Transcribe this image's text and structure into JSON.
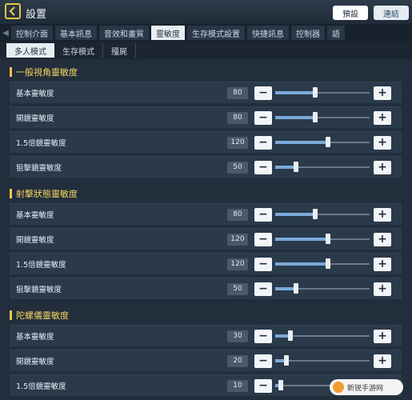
{
  "header": {
    "title": "設置",
    "preset_label": "預設",
    "connect_label": "連結"
  },
  "tabs": [
    {
      "label": "控制介面",
      "active": false
    },
    {
      "label": "基本訊息",
      "active": false
    },
    {
      "label": "音效和畫質",
      "active": false
    },
    {
      "label": "靈敏度",
      "active": true
    },
    {
      "label": "生存模式設置",
      "active": false
    },
    {
      "label": "快捷訊息",
      "active": false
    },
    {
      "label": "控制器",
      "active": false
    },
    {
      "label": "語",
      "active": false
    }
  ],
  "subtabs": [
    {
      "label": "多人模式",
      "active": true
    },
    {
      "label": "生存模式",
      "active": false
    },
    {
      "label": "殭屍",
      "active": false
    }
  ],
  "sections": [
    {
      "title": "一般視角靈敏度",
      "rows": [
        {
          "label": "基本靈敏度",
          "value": "80",
          "level": 0.42
        },
        {
          "label": "開鏡靈敏度",
          "value": "80",
          "level": 0.42
        },
        {
          "label": "1.5倍鏡靈敏度",
          "value": "120",
          "level": 0.56
        },
        {
          "label": "狙擊鏡靈敏度",
          "value": "50",
          "level": 0.22
        }
      ]
    },
    {
      "title": "射擊狀態靈敏度",
      "rows": [
        {
          "label": "基本靈敏度",
          "value": "80",
          "level": 0.42
        },
        {
          "label": "開鏡靈敏度",
          "value": "120",
          "level": 0.56
        },
        {
          "label": "1.5倍鏡靈敏度",
          "value": "120",
          "level": 0.56
        },
        {
          "label": "狙擊鏡靈敏度",
          "value": "50",
          "level": 0.22
        }
      ]
    },
    {
      "title": "陀螺儀靈敏度",
      "rows": [
        {
          "label": "基本靈敏度",
          "value": "30",
          "level": 0.16
        },
        {
          "label": "開鏡靈敏度",
          "value": "20",
          "level": 0.12
        },
        {
          "label": "1.5倍鏡靈敏度",
          "value": "10",
          "level": 0.06
        }
      ]
    }
  ],
  "watermark": {
    "text": "新锐手游网"
  },
  "colors": {
    "accent": "#f3c64a",
    "fill": "#7ba9d8"
  }
}
